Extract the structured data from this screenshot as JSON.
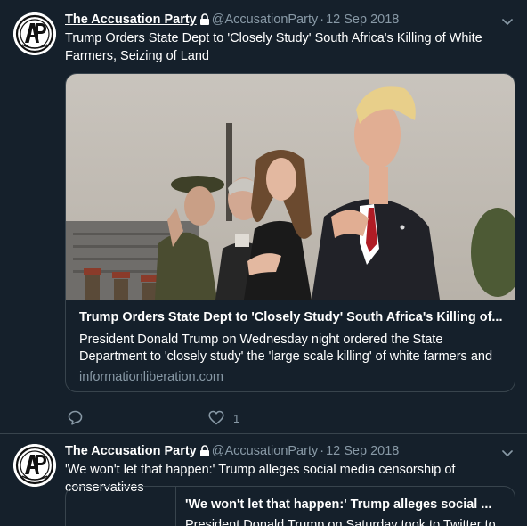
{
  "tweets": [
    {
      "author_name": "The Accusation Party",
      "handle": "@AccusationParty",
      "separator": "·",
      "date": "12 Sep 2018",
      "text": "Trump Orders State Dept to 'Closely Study' South Africa's Killing of White Farmers, Seizing of Land",
      "card": {
        "title": "Trump Orders State Dept to 'Closely Study' South Africa's Killing of...",
        "description": "President Donald Trump on Wednesday night ordered the State Department to 'closely study' the 'large scale killing' of white farmers and",
        "domain": "informationliberation.com"
      },
      "likes": "1"
    },
    {
      "author_name": "The Accusation Party",
      "handle": "@AccusationParty",
      "separator": "·",
      "date": "12 Sep 2018",
      "text": "'We won't let that happen:' Trump alleges social media censorship of conservatives",
      "card": {
        "title": "'We won't let that happen:' Trump alleges social ...",
        "description": "President Donald Trump on Saturday took to Twitter to"
      }
    }
  ],
  "icons": {
    "avatar": "ap-logo-icon",
    "lock": "lock-icon",
    "caret": "chevron-down-icon",
    "reply": "reply-icon",
    "like": "heart-icon"
  },
  "colors": {
    "background": "#15202b",
    "border": "#38444d",
    "secondary_text": "#8899a6",
    "primary_text": "#ffffff"
  }
}
